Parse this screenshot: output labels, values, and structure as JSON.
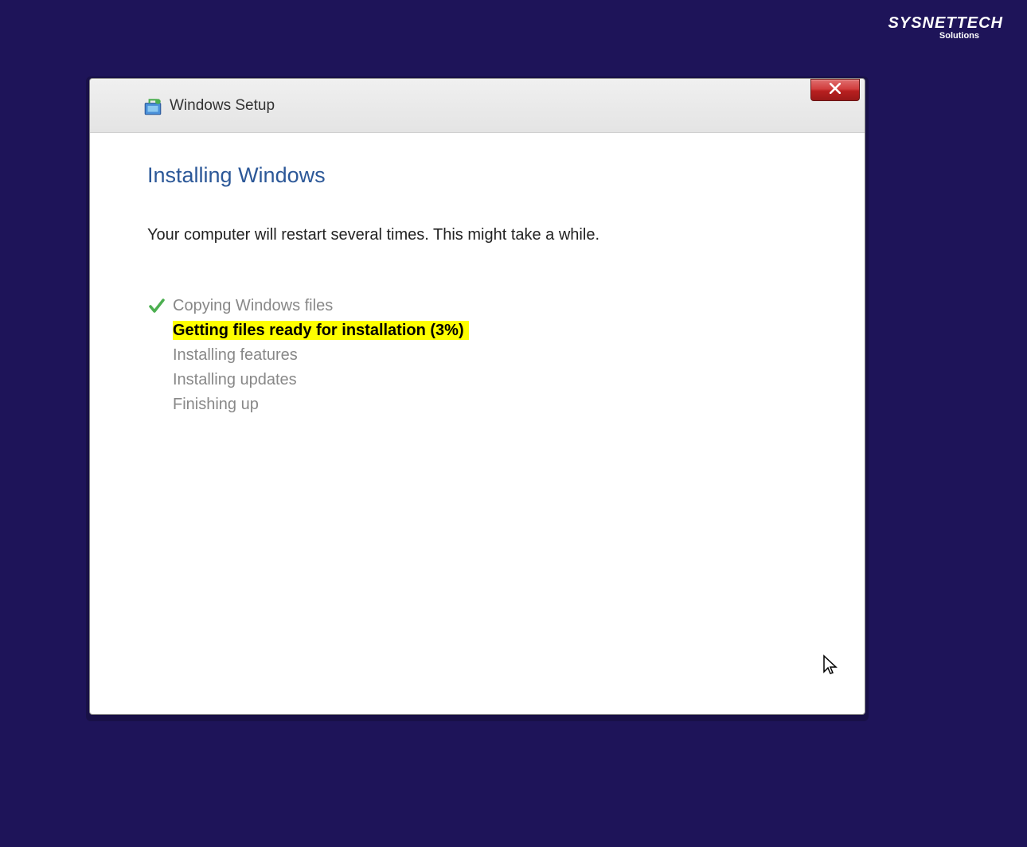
{
  "watermark": {
    "main": "SYSNETTECH",
    "sub": "Solutions"
  },
  "dialog": {
    "title": "Windows Setup",
    "heading": "Installing Windows",
    "subtext": "Your computer will restart several times. This might take a while.",
    "steps": [
      {
        "label": "Copying Windows files",
        "status": "done"
      },
      {
        "label": "Getting files ready for installation (3%)",
        "status": "active"
      },
      {
        "label": "Installing features",
        "status": "pending"
      },
      {
        "label": "Installing updates",
        "status": "pending"
      },
      {
        "label": "Finishing up",
        "status": "pending"
      }
    ],
    "progress_percent": 3
  }
}
